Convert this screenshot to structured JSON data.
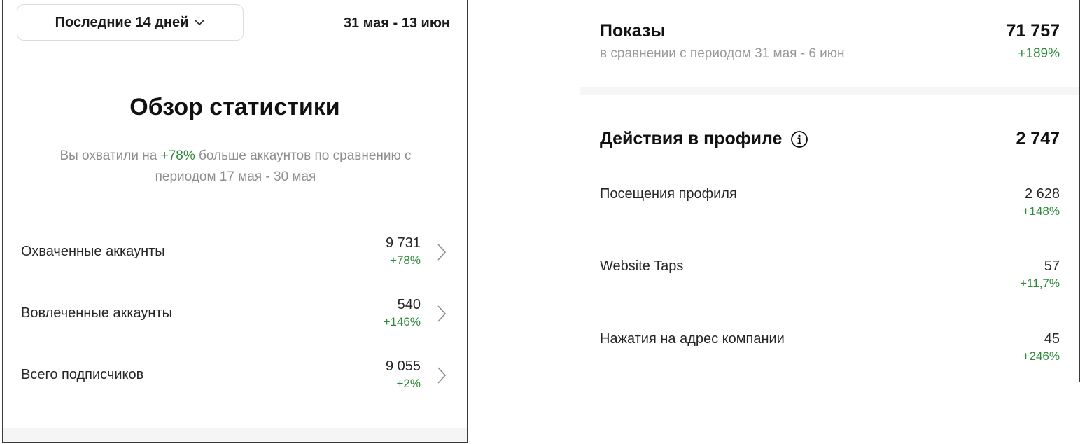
{
  "left": {
    "range_button": "Последние 14 дней",
    "date_range": "31 мая - 13 июн",
    "title": "Обзор статистики",
    "subtitle_prefix": "Вы охватили на",
    "subtitle_pct": "+78%",
    "subtitle_suffix": "больше аккаунтов по сравнению с периодом 17 мая - 30 мая",
    "stats": [
      {
        "label": "Охваченные аккаунты",
        "value": "9 731",
        "delta": "+78%"
      },
      {
        "label": "Вовлеченные аккаунты",
        "value": "540",
        "delta": "+146%"
      },
      {
        "label": "Всего подписчиков",
        "value": "9 055",
        "delta": "+2%"
      }
    ]
  },
  "right": {
    "impressions": {
      "title": "Показы",
      "subtitle": "в сравнении с периодом 31 мая - 6 июн",
      "value": "71 757",
      "delta": "+189%"
    },
    "actions": {
      "title": "Действия в профиле",
      "total": "2 747",
      "rows": [
        {
          "label": "Посещения профиля",
          "value": "2 628",
          "delta": "+148%"
        },
        {
          "label": "Website Taps",
          "value": "57",
          "delta": "+11,7%"
        },
        {
          "label": "Нажатия на адрес компании",
          "value": "45",
          "delta": "+246%"
        }
      ]
    }
  },
  "colors": {
    "positive": "#2e8b3a",
    "muted": "#8e8e8e"
  },
  "icons": [
    "chevron-down-icon",
    "chevron-right-icon",
    "info-icon"
  ]
}
